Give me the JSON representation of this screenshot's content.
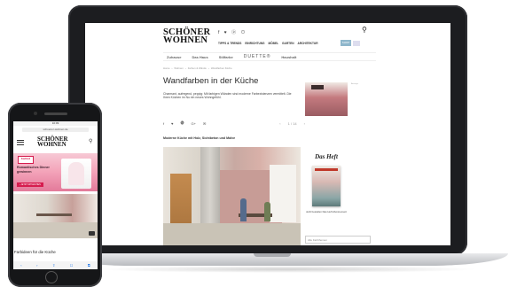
{
  "laptop": {
    "logo_line1": "SCHÖNER",
    "logo_line2": "WOHNEN",
    "social": "f ♥ ⓟ ⊙",
    "nav": [
      "TIPPS & TRENDS",
      "EINRICHTUNG",
      "MÖBEL",
      "GARTEN",
      "ARCHITEKTUR"
    ],
    "nav_button": "SHOP",
    "brands": [
      "Zuhause",
      "Das Haus",
      "Stilfarbe",
      "DUETTE®",
      "Haushalt"
    ],
    "breadcrumb": [
      "Home",
      "›",
      "Wohnen",
      "›",
      "Farben & Wände",
      "›",
      "Wandfarben Küche"
    ],
    "headline": "Wandfarben in der Küche",
    "teaser": "Charmant, aufregend, peppig: Mit farbigen Wänden sind moderne Farbexistenzen vermittelt. Die Ihren Küchen im Nu ein neues Wohngefühl.",
    "share_icons": [
      "f",
      "♥",
      "⓰",
      "G+",
      "✉"
    ],
    "pager": [
      "‹",
      "1 / 14",
      "›"
    ],
    "subhead": "Moderne Küche mit Holz, Sichtbeton und Malve",
    "ad_tag": "Anzeige",
    "heft_title": "Das Heft",
    "heft_text": "Jetzt bestellen\nDas Heft Abonnement",
    "color_search_placeholder": "Alle Farbthemen"
  },
  "phone": {
    "status": "10:09",
    "url": "schoener-wohnen.de",
    "logo_line1": "SCHÖNER",
    "logo_line2": "WOHNEN",
    "ad_badge": "Kaufland",
    "ad_text": "Romantisches Dinner gewinnen",
    "ad_button": "› JETZT MITMACHEN",
    "caption": "Farbideen für die Küche",
    "toolbar": [
      "‹",
      "›",
      "⇧",
      "☐",
      "⧉"
    ]
  }
}
